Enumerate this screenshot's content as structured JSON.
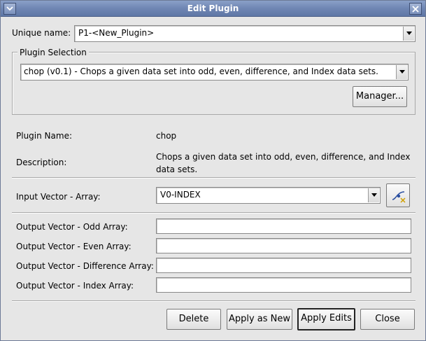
{
  "window": {
    "title": "Edit Plugin"
  },
  "unique_name": {
    "label": "Unique name:",
    "value": "P1-<New_Plugin>"
  },
  "plugin_selection": {
    "group_title": "Plugin Selection",
    "selected": "chop (v0.1) - Chops a given data set into odd, even, difference, and Index data sets.",
    "manager_button": "Manager..."
  },
  "plugin_info": {
    "name_label": "Plugin Name:",
    "name_value": "chop",
    "description_label": "Description:",
    "description_line1": "Chops a given data set into odd, even, difference, and Index",
    "description_line2": "data sets."
  },
  "input_vector": {
    "label": "Input Vector - Array:",
    "value": "V0-INDEX",
    "select_icon": "vector-select-icon"
  },
  "outputs": [
    {
      "label": "Output Vector - Odd Array:",
      "value": ""
    },
    {
      "label": "Output Vector - Even Array:",
      "value": ""
    },
    {
      "label": "Output Vector - Difference Array:",
      "value": ""
    },
    {
      "label": "Output Vector - Index Array:",
      "value": ""
    }
  ],
  "buttons": {
    "delete": "Delete",
    "apply_as_new": "Apply as New",
    "apply_edits": "Apply Edits",
    "close": "Close"
  },
  "colors": {
    "titlebar": "#6f86b3",
    "background": "#e6e6e6"
  }
}
